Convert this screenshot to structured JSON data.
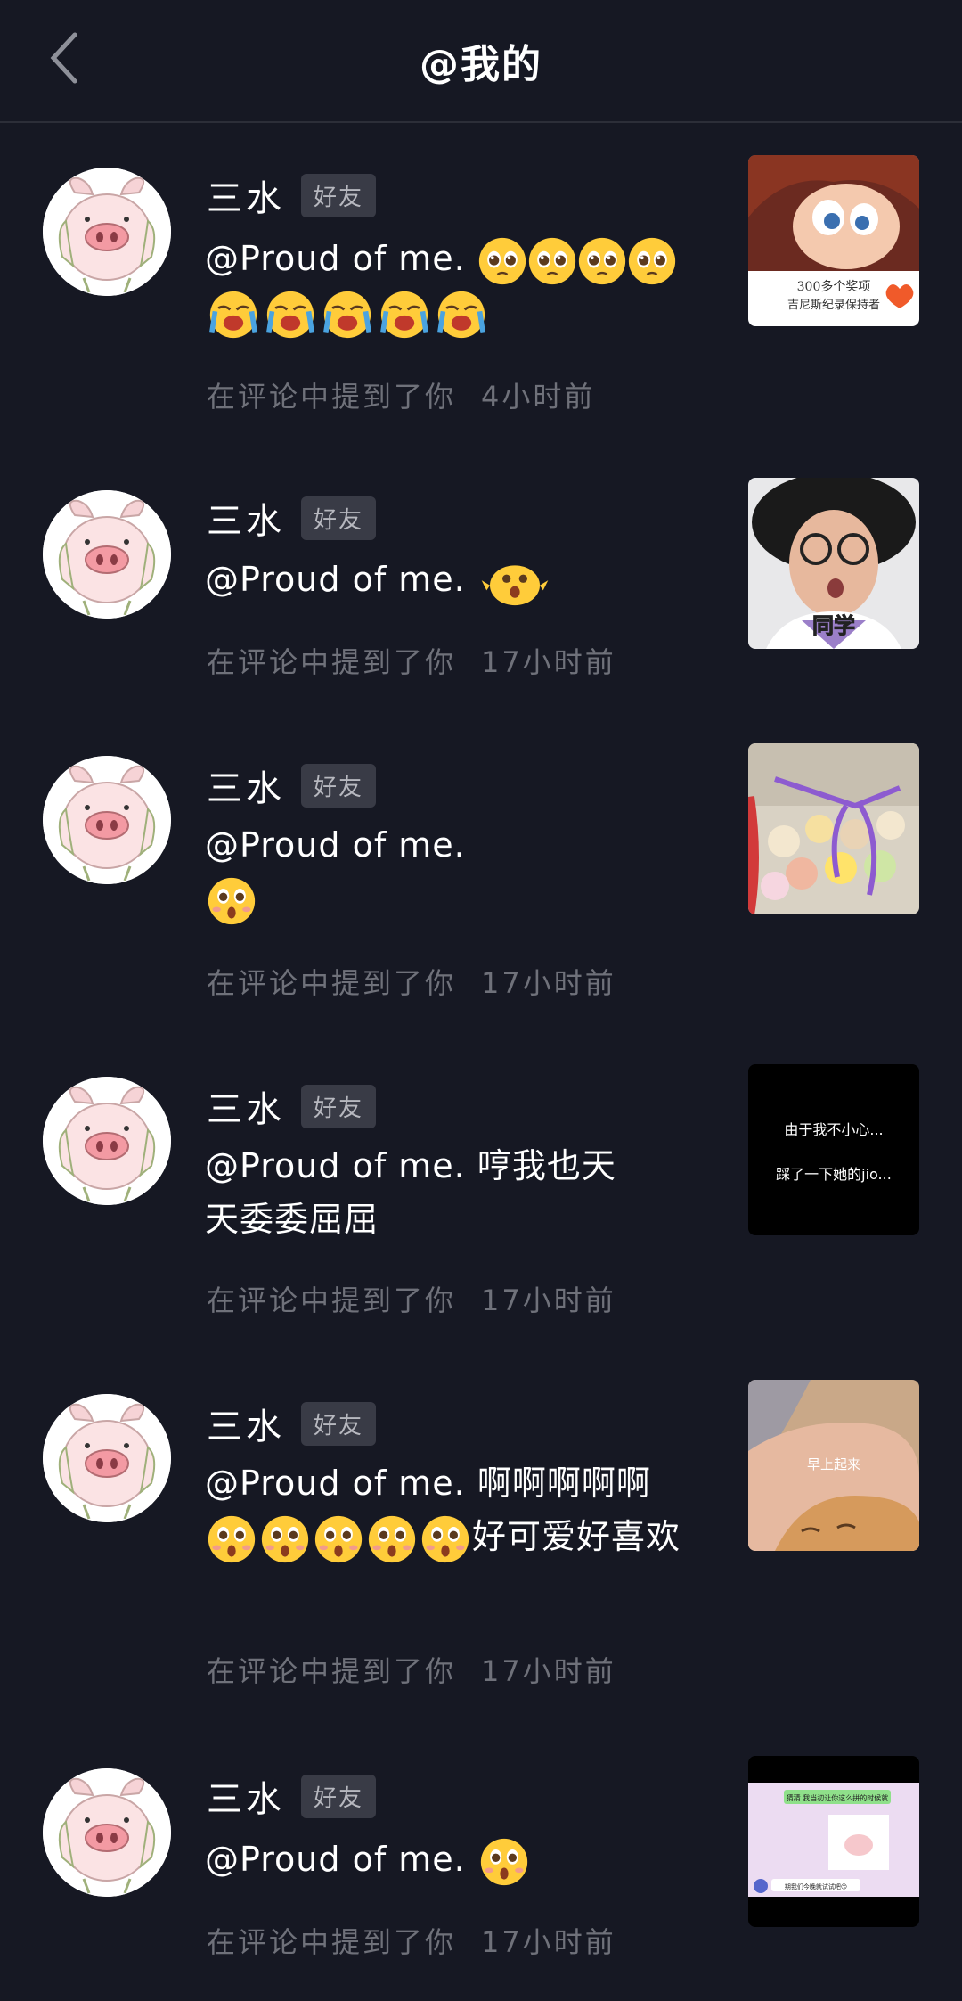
{
  "header": {
    "title": "@我的"
  },
  "badge_label": "好友",
  "items": [
    {
      "name": "三水",
      "comment_prefix": "@Proud of me.",
      "comment_suffix": "",
      "meta": "在评论中提到了你",
      "time": "4小时前",
      "thumb": {
        "caption_1": "300多个奖项",
        "caption_2": "吉尼斯纪录保持者"
      }
    },
    {
      "name": "三水",
      "comment_prefix": "@Proud of me.",
      "comment_suffix": "",
      "meta": "在评论中提到了你",
      "time": "17小时前",
      "thumb": {
        "caption": "同学"
      }
    },
    {
      "name": "三水",
      "comment_prefix": "@Proud of me.",
      "comment_suffix": "",
      "meta": "在评论中提到了你",
      "time": "17小时前",
      "thumb": {}
    },
    {
      "name": "三水",
      "comment_prefix": "@Proud of me. 哼我也天天委委屈屈",
      "comment_suffix": "",
      "meta": "在评论中提到了你",
      "time": "17小时前",
      "thumb": {
        "line_1": "由于我不小心...",
        "line_2": "踩了一下她的jio..."
      }
    },
    {
      "name": "三水",
      "comment_prefix": "@Proud of me. 啊啊啊啊啊",
      "comment_suffix": "好可爱好喜欢",
      "meta": "在评论中提到了你",
      "time": "17小时前",
      "thumb": {
        "caption": "早上起来"
      }
    },
    {
      "name": "三水",
      "comment_prefix": "@Proud of me.",
      "comment_suffix": "",
      "meta": "在评论中提到了你",
      "time": "17小时前",
      "thumb": {
        "top_text": "猜猜 我当初让你这么拼的时候就",
        "bottom_text": "期我们今晚就试试吧😏"
      }
    }
  ],
  "colors": {
    "background": "#161823",
    "badge_bg": "#393b46",
    "meta": "#6f717a"
  }
}
